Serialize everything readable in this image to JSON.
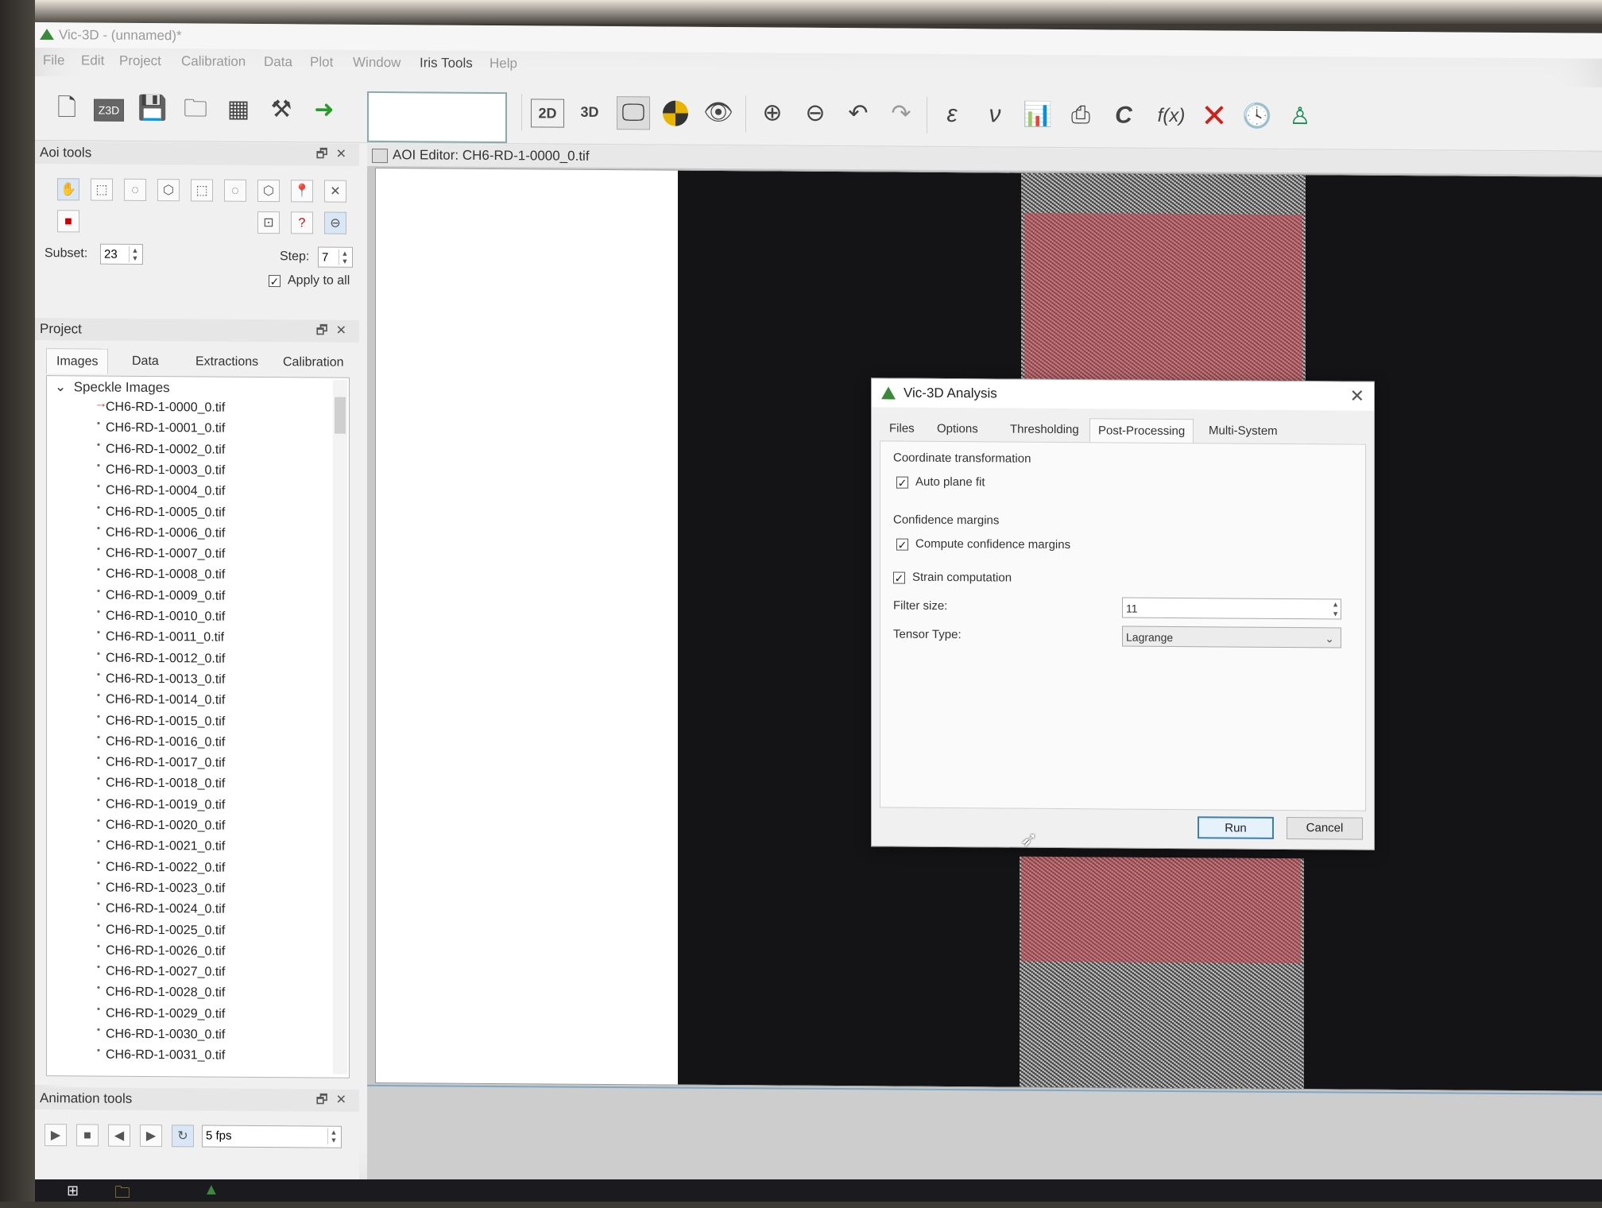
{
  "app": {
    "title": "Vic-3D - (unnamed)*",
    "menu": [
      "File",
      "Edit",
      "Project",
      "Calibration",
      "Data",
      "Plot",
      "Window",
      "Iris Tools",
      "Help"
    ]
  },
  "toolbar": {
    "btn_2d": "2D",
    "btn_3d": "3D",
    "epsilon": "ε",
    "nu": "ν",
    "c_label": "C",
    "fx": "f(x)"
  },
  "aoi_tools": {
    "title": "Aoi tools",
    "subset_label": "Subset:",
    "subset_value": "23",
    "step_label": "Step:",
    "step_value": "7",
    "apply_to_all": "Apply to all"
  },
  "project": {
    "title": "Project",
    "tabs": [
      "Images",
      "Data",
      "Extractions",
      "Calibration"
    ],
    "group": "Speckle Images",
    "files": [
      "CH6-RD-1-0000_0.tif",
      "CH6-RD-1-0001_0.tif",
      "CH6-RD-1-0002_0.tif",
      "CH6-RD-1-0003_0.tif",
      "CH6-RD-1-0004_0.tif",
      "CH6-RD-1-0005_0.tif",
      "CH6-RD-1-0006_0.tif",
      "CH6-RD-1-0007_0.tif",
      "CH6-RD-1-0008_0.tif",
      "CH6-RD-1-0009_0.tif",
      "CH6-RD-1-0010_0.tif",
      "CH6-RD-1-0011_0.tif",
      "CH6-RD-1-0012_0.tif",
      "CH6-RD-1-0013_0.tif",
      "CH6-RD-1-0014_0.tif",
      "CH6-RD-1-0015_0.tif",
      "CH6-RD-1-0016_0.tif",
      "CH6-RD-1-0017_0.tif",
      "CH6-RD-1-0018_0.tif",
      "CH6-RD-1-0019_0.tif",
      "CH6-RD-1-0020_0.tif",
      "CH6-RD-1-0021_0.tif",
      "CH6-RD-1-0022_0.tif",
      "CH6-RD-1-0023_0.tif",
      "CH6-RD-1-0024_0.tif",
      "CH6-RD-1-0025_0.tif",
      "CH6-RD-1-0026_0.tif",
      "CH6-RD-1-0027_0.tif",
      "CH6-RD-1-0028_0.tif",
      "CH6-RD-1-0029_0.tif",
      "CH6-RD-1-0030_0.tif",
      "CH6-RD-1-0031_0.tif"
    ]
  },
  "animation": {
    "title": "Animation tools",
    "fps": "5 fps"
  },
  "editor": {
    "title": "AOI Editor: CH6-RD-1-0000_0.tif"
  },
  "dialog": {
    "title": "Vic-3D Analysis",
    "tabs": [
      "Files",
      "Options",
      "Thresholding",
      "Post-Processing",
      "Multi-System"
    ],
    "active_tab": "Post-Processing",
    "coord_group": "Coordinate transformation",
    "auto_plane_fit": "Auto plane fit",
    "conf_group": "Confidence margins",
    "compute_conf": "Compute confidence margins",
    "strain": "Strain computation",
    "filter_label": "Filter size:",
    "filter_value": "11",
    "tensor_label": "Tensor Type:",
    "tensor_value": "Lagrange",
    "run": "Run",
    "cancel": "Cancel"
  }
}
